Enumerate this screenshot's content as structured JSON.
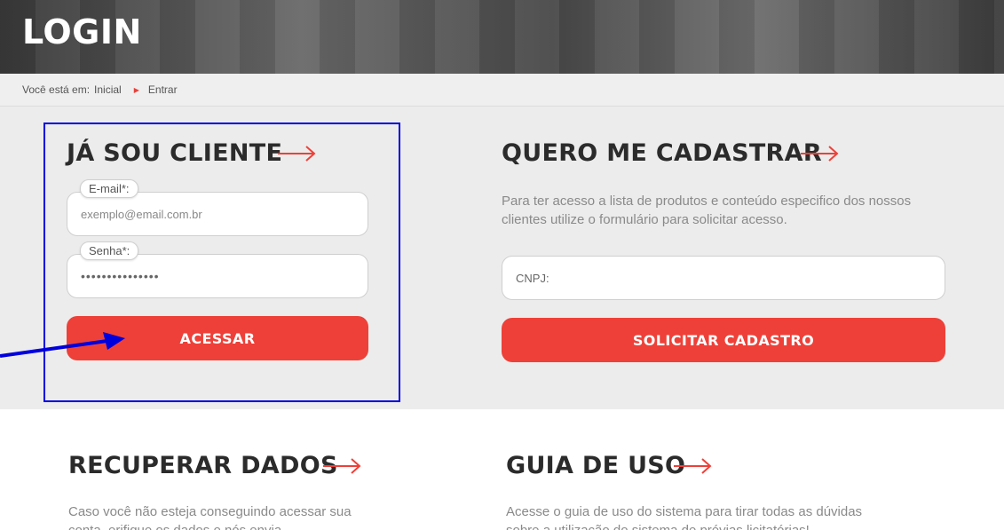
{
  "header": {
    "title": "LOGIN"
  },
  "breadcrumb": {
    "prefix": "Você está em:",
    "home": "Inicial",
    "current": "Entrar"
  },
  "login": {
    "title": "JÁ SOU CLIENTE",
    "email_label": "E-mail*:",
    "email_placeholder": "exemplo@email.com.br",
    "password_label": "Senha*:",
    "password_value": "•••••••••••••••",
    "submit_label": "ACESSAR"
  },
  "register": {
    "title": "QUERO ME CADASTRAR",
    "description": "Para ter acesso a lista de produtos e conteúdo especifico dos nossos clientes utilize o formulário para solicitar acesso.",
    "cnpj_placeholder": "CNPJ:",
    "submit_label": "SOLICITAR CADASTRO"
  },
  "recover": {
    "title": "RECUPERAR DADOS",
    "description": "Caso você não esteja conseguindo acessar sua conta, erifique os dados e nós envia"
  },
  "guide": {
    "title": "GUIA DE USO",
    "description": "Acesse o guia de uso do sistema para tirar todas as dúvidas sobre a utilização do sistema de prévias licitatórias!"
  },
  "colors": {
    "accent": "#ee4038",
    "annotation": "#0000dd"
  }
}
